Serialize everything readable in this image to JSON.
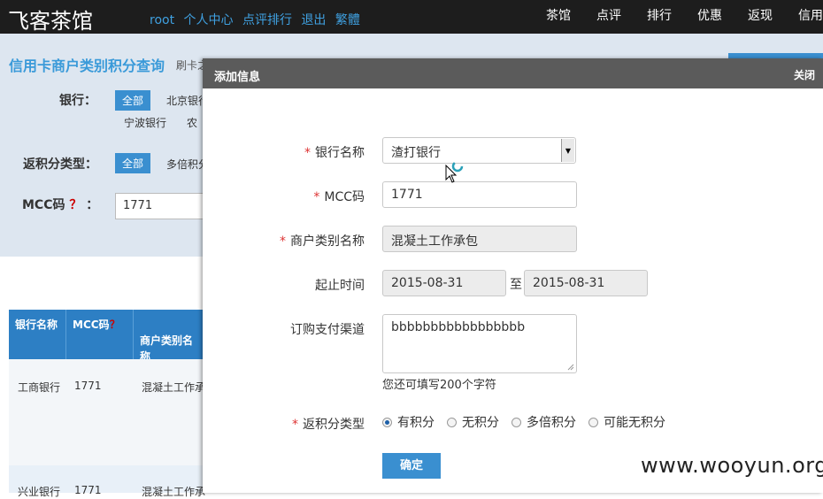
{
  "topbar": {
    "logo": "飞客茶馆",
    "user_links": [
      "root",
      "个人中心",
      "点评排行",
      "退出",
      "繁體"
    ],
    "nav": [
      "茶馆",
      "点评",
      "排行",
      "优惠",
      "返现",
      "信用"
    ]
  },
  "page": {
    "title": "信用卡商户类别积分查询",
    "subtitle": "刷卡之",
    "bank_label": "银行：",
    "bank_all": "全部",
    "bank_items": [
      "北京银行",
      "宁波银行",
      "农"
    ],
    "rebate_label": "返积分类型：",
    "rebate_all": "全部",
    "rebate_items": [
      "多倍积分"
    ],
    "mcc_label": "MCC码",
    "mcc_q": "？",
    "mcc_colon": "：",
    "mcc_value": "1771"
  },
  "table": {
    "headers": [
      "银行名称",
      "MCC码",
      "商户类别名称"
    ],
    "header_q": "？",
    "rows": [
      {
        "bank": "工商银行",
        "mcc": "1771",
        "name": "混凝土工作承"
      },
      {
        "bank": "兴业银行",
        "mcc": "1771",
        "name": "混凝土工作承"
      }
    ]
  },
  "dialog": {
    "title": "添加信息",
    "close": "关闭",
    "req_mark": "*",
    "bank_name_label": "银行名称",
    "bank_name_value": "渣打银行",
    "mcc_label": "MCC码",
    "mcc_value": "1771",
    "merchant_label": "商户类别名称",
    "merchant_value": "混凝土工作承包",
    "period_label": "起止时间",
    "start_date": "2015-08-31",
    "to": "至",
    "end_date": "2015-08-31",
    "channel_label": "订购支付渠道",
    "channel_value": "bbbbbbbbbbbbbbbbb",
    "remaining_hint": "您还可填写200个字符",
    "rebate_type_label": "返积分类型",
    "rebate_options": [
      "有积分",
      "无积分",
      "多倍积分",
      "可能无积分"
    ],
    "rebate_selected": 0,
    "submit": "确定"
  },
  "watermark": "www.wooyun.org",
  "colors": {
    "accent": "#3a8fd0",
    "topbar": "#1d1d1d",
    "dialog_header": "#5b5b5b",
    "required": "#d33333"
  }
}
